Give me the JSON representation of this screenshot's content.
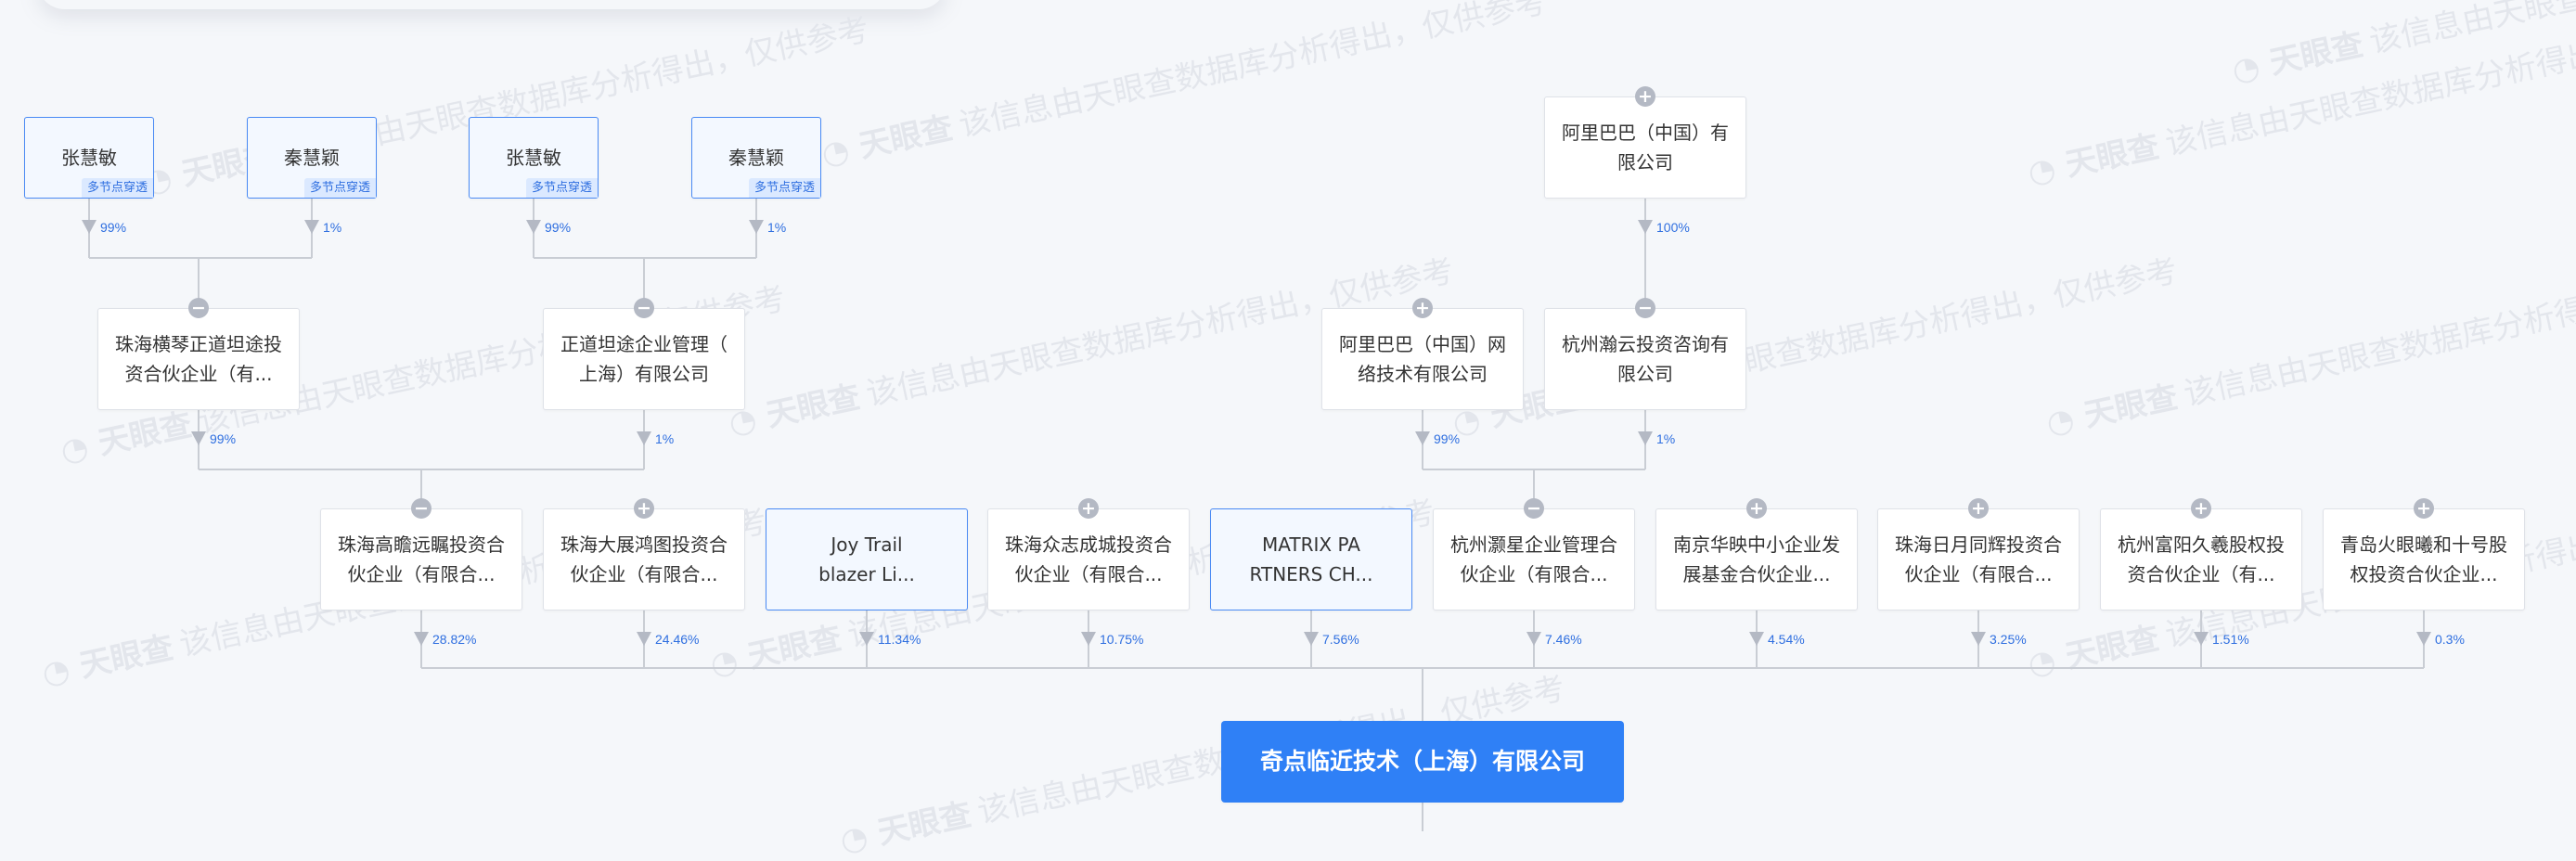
{
  "watermark": {
    "logo_text": "天眼查",
    "text": "该信息由天眼查数据库分析得出，仅供参考"
  },
  "colors": {
    "accent": "#2f80f6",
    "person_border": "#4a8af4",
    "line": "#c9cdd4",
    "percent_text": "#2f6fe0",
    "toggle": "#b4b9c4"
  },
  "tag_label": "多节点穿透",
  "nodes": [
    {
      "id": "p1",
      "label": "张慧敏",
      "type": "person",
      "tag": true
    },
    {
      "id": "p2",
      "label": "秦慧颖",
      "type": "person",
      "tag": true
    },
    {
      "id": "p3",
      "label": "张慧敏",
      "type": "person",
      "tag": true
    },
    {
      "id": "p4",
      "label": "秦慧颖",
      "type": "person",
      "tag": true
    },
    {
      "id": "alibaba_cn",
      "label": "阿里巴巴（中国）有\n限公司",
      "type": "company",
      "toggle": "+"
    },
    {
      "id": "hengqin",
      "label": "珠海横琴正道坦途投\n资合伙企业（有...",
      "type": "company",
      "toggle": "−"
    },
    {
      "id": "zhengdao",
      "label": "正道坦途企业管理（\n上海）有限公司",
      "type": "company",
      "toggle": "−"
    },
    {
      "id": "alibaba_net",
      "label": "阿里巴巴（中国）网\n络技术有限公司",
      "type": "company",
      "toggle": "+"
    },
    {
      "id": "hanyun",
      "label": "杭州瀚云投资咨询有\n限公司",
      "type": "company",
      "toggle": "−"
    },
    {
      "id": "gaozhan",
      "label": "珠海高瞻远瞩投资合\n伙企业（有限合...",
      "type": "company",
      "toggle": "−"
    },
    {
      "id": "dazhan",
      "label": "珠海大展鸿图投资合\n伙企业（有限合...",
      "type": "company",
      "toggle": "+"
    },
    {
      "id": "joytrail",
      "label": "Joy Trail\nblazer Li...",
      "type": "highlight"
    },
    {
      "id": "zhongzhi",
      "label": "珠海众志成城投资合\n伙企业（有限合...",
      "type": "company",
      "toggle": "+"
    },
    {
      "id": "matrix",
      "label": "MATRIX PA\nRTNERS CH...",
      "type": "highlight"
    },
    {
      "id": "haoxing",
      "label": "杭州灏星企业管理合\n伙企业（有限合...",
      "type": "company",
      "toggle": "−"
    },
    {
      "id": "nanjing",
      "label": "南京华映中小企业发\n展基金合伙企业...",
      "type": "company",
      "toggle": "+"
    },
    {
      "id": "riyue",
      "label": "珠海日月同辉投资合\n伙企业（有限合...",
      "type": "company",
      "toggle": "+"
    },
    {
      "id": "fuyang",
      "label": "杭州富阳久羲股权投\n资合伙企业（有...",
      "type": "company",
      "toggle": "+"
    },
    {
      "id": "qingdao",
      "label": "青岛火眼曦和十号股\n权投资合伙企业...",
      "type": "company",
      "toggle": "+"
    },
    {
      "id": "root",
      "label": "奇点临近技术（上海）有限公司",
      "type": "root"
    }
  ],
  "edges": [
    {
      "from": "p1",
      "to": "hengqin",
      "percent": "99%"
    },
    {
      "from": "p2",
      "to": "hengqin",
      "percent": "1%"
    },
    {
      "from": "p3",
      "to": "zhengdao",
      "percent": "99%"
    },
    {
      "from": "p4",
      "to": "zhengdao",
      "percent": "1%"
    },
    {
      "from": "alibaba_cn",
      "to": "hanyun",
      "percent": "100%"
    },
    {
      "from": "hengqin",
      "to": "gaozhan",
      "percent": "99%"
    },
    {
      "from": "zhengdao",
      "to": "gaozhan",
      "percent": "1%"
    },
    {
      "from": "alibaba_net",
      "to": "haoxing",
      "percent": "99%"
    },
    {
      "from": "hanyun",
      "to": "haoxing",
      "percent": "1%"
    },
    {
      "from": "gaozhan",
      "to": "root",
      "percent": "28.82%"
    },
    {
      "from": "dazhan",
      "to": "root",
      "percent": "24.46%"
    },
    {
      "from": "joytrail",
      "to": "root",
      "percent": "11.34%"
    },
    {
      "from": "zhongzhi",
      "to": "root",
      "percent": "10.75%"
    },
    {
      "from": "matrix",
      "to": "root",
      "percent": "7.56%"
    },
    {
      "from": "haoxing",
      "to": "root",
      "percent": "7.46%"
    },
    {
      "from": "nanjing",
      "to": "root",
      "percent": "4.54%"
    },
    {
      "from": "riyue",
      "to": "root",
      "percent": "3.25%"
    },
    {
      "from": "fuyang",
      "to": "root",
      "percent": "1.51%"
    },
    {
      "from": "qingdao",
      "to": "root",
      "percent": "0.3%"
    }
  ]
}
